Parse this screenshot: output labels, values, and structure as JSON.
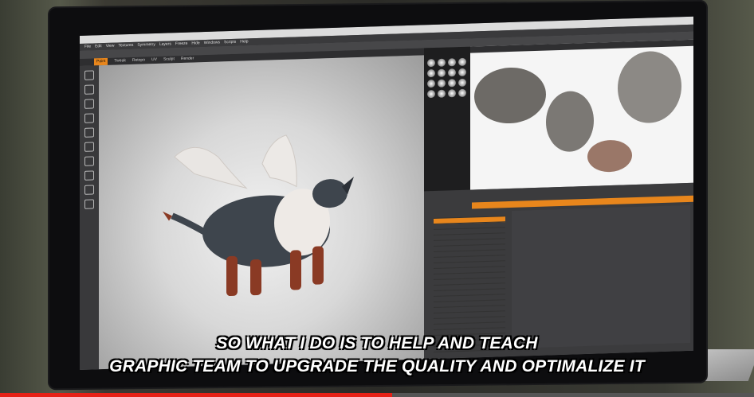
{
  "caption": {
    "line1": "SO WHAT I DO IS TO HELP AND TEACH",
    "line2": "GRAPHIC TEAM TO UPGRADE THE QUALITY AND OPTIMALIZE IT"
  },
  "video": {
    "progress_fraction": 0.52,
    "progress_color": "#e62117"
  },
  "app": {
    "menu": [
      "File",
      "Edit",
      "View",
      "Textures",
      "Symmetry",
      "Layers",
      "Freeze",
      "Hide",
      "Windows",
      "Scripts",
      "Help"
    ],
    "tabs": [
      "Paint",
      "Tweak",
      "Retopo",
      "UV",
      "Sculpt",
      "Render"
    ],
    "active_tab_index": 0,
    "accent_color": "#e8861c"
  },
  "colors": {
    "creature_dark": "#3e454d",
    "creature_white": "#eeeae6",
    "creature_red": "#8a3a24"
  }
}
